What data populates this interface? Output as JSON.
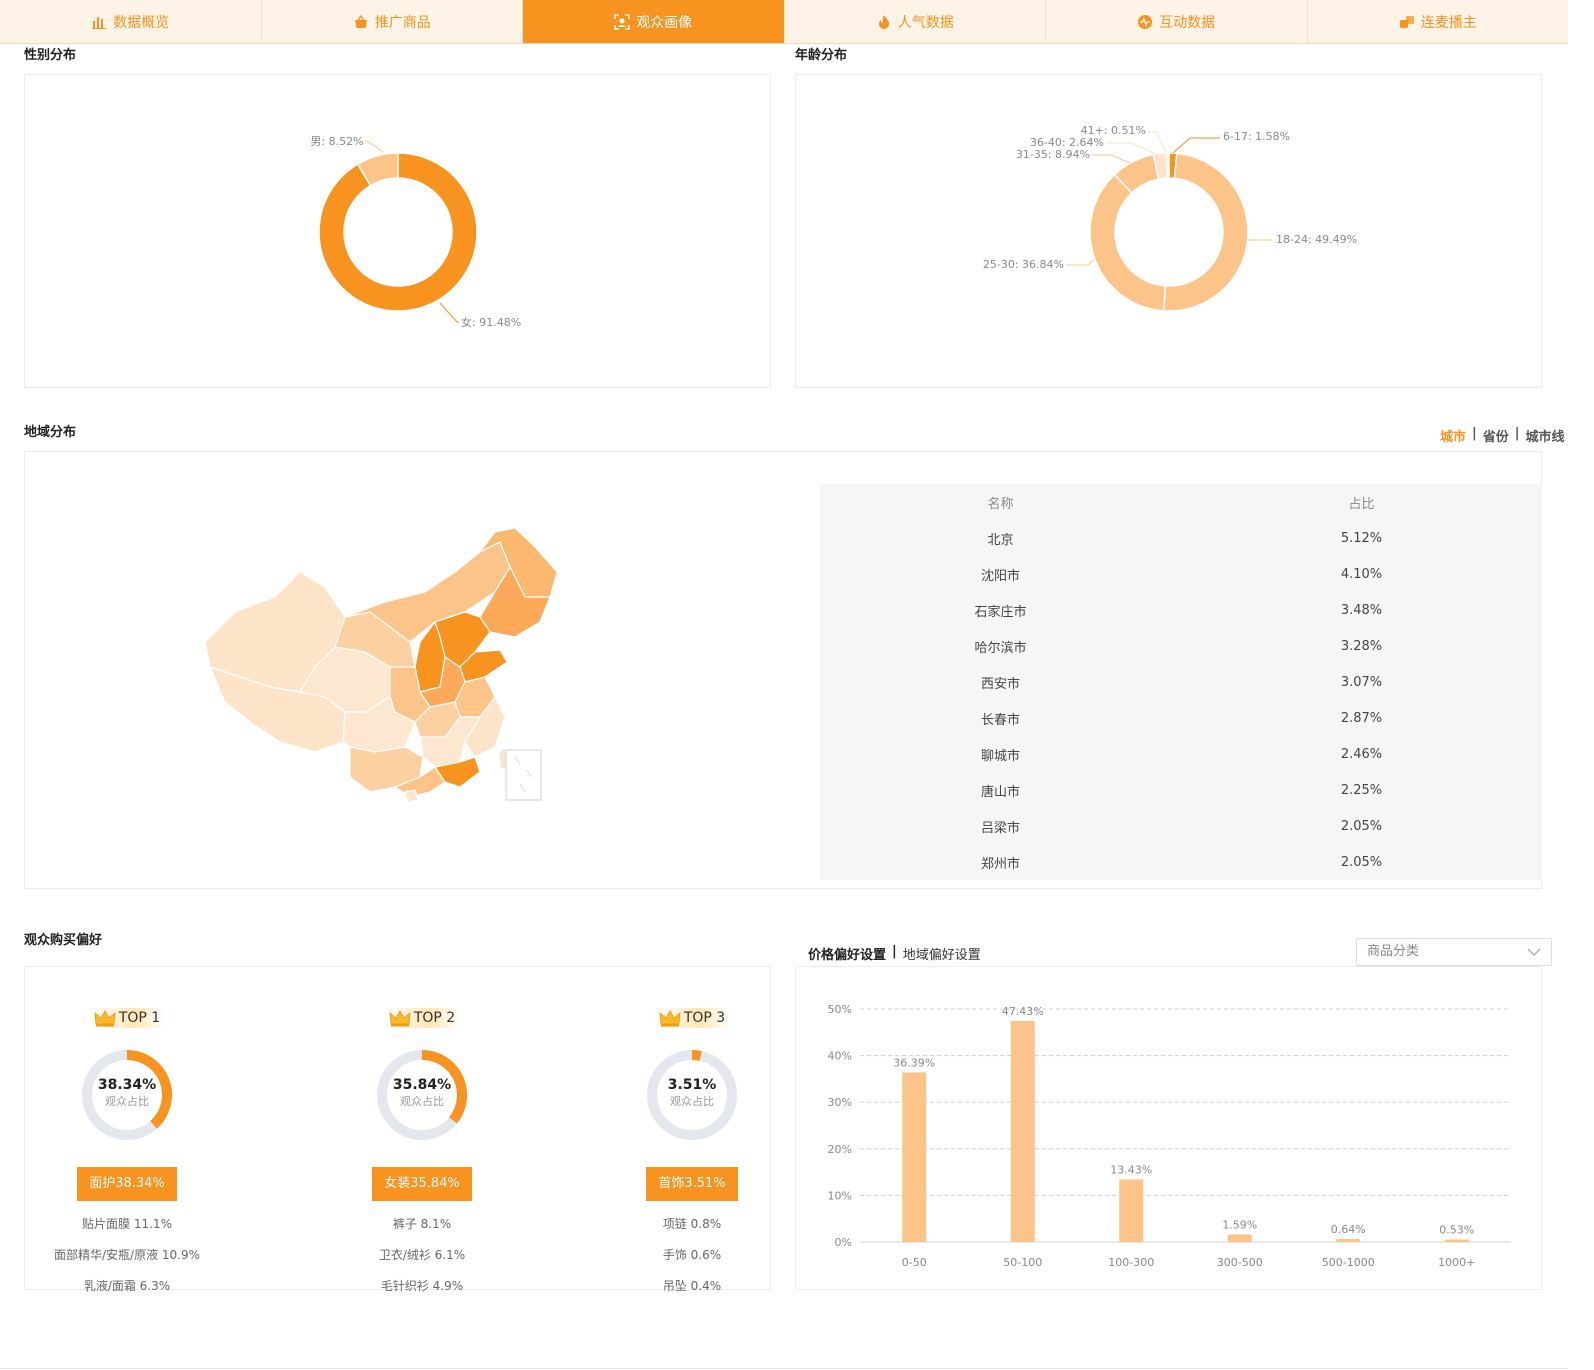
{
  "tabs": [
    {
      "label": "数据概览",
      "icon": "bar-chart-icon"
    },
    {
      "label": "推广商品",
      "icon": "shopping-basket-icon"
    },
    {
      "label": "观众画像",
      "icon": "face-scan-icon"
    },
    {
      "label": "人气数据",
      "icon": "flame-icon"
    },
    {
      "label": "互动数据",
      "icon": "pulse-icon"
    },
    {
      "label": "连麦播主",
      "icon": "link-mic-icon"
    }
  ],
  "active_tab": "观众画像",
  "colors": {
    "accent": "#f7931e",
    "light": "#fdc48a",
    "lighter": "#fde3c8",
    "tab_bg": "#fdf3e7"
  },
  "gender": {
    "title": "性别分布",
    "labels": [
      "男: 8.52%",
      "女: 91.48%"
    ],
    "chart_data": {
      "type": "pie",
      "categories": [
        "男",
        "女"
      ],
      "values": [
        8.52,
        91.48
      ]
    }
  },
  "age": {
    "title": "年龄分布",
    "labels": [
      "6-17: 1.58%",
      "18-24: 49.49%",
      "25-30: 36.84%",
      "31-35: 8.94%",
      "36-40: 2.64%",
      "41+: 0.51%"
    ],
    "chart_data": {
      "type": "pie",
      "categories": [
        "6-17",
        "18-24",
        "25-30",
        "31-35",
        "36-40",
        "41+"
      ],
      "values": [
        1.58,
        49.49,
        36.84,
        8.94,
        2.64,
        0.51
      ]
    }
  },
  "region": {
    "title": "地域分布",
    "toggles": [
      "城市",
      "省份",
      "城市线"
    ],
    "active_toggle": "城市",
    "table": {
      "headers": [
        "名称",
        "占比"
      ],
      "rows": [
        [
          "北京",
          "5.12%"
        ],
        [
          "沈阳市",
          "4.10%"
        ],
        [
          "石家庄市",
          "3.48%"
        ],
        [
          "哈尔滨市",
          "3.28%"
        ],
        [
          "西安市",
          "3.07%"
        ],
        [
          "长春市",
          "2.87%"
        ],
        [
          "聊城市",
          "2.46%"
        ],
        [
          "唐山市",
          "2.25%"
        ],
        [
          "吕梁市",
          "2.05%"
        ],
        [
          "郑州市",
          "2.05%"
        ]
      ]
    }
  },
  "preference": {
    "title": "观众购买偏好",
    "donut_label": "观众占比",
    "items": [
      {
        "rank": "TOP 1",
        "pct": "38.34%",
        "value": 38.34,
        "category": "面护38.34%",
        "subs": [
          "贴片面膜 11.1%",
          "面部精华/安瓶/原液 10.9%",
          "乳液/面霜 6.3%"
        ]
      },
      {
        "rank": "TOP 2",
        "pct": "35.84%",
        "value": 35.84,
        "category": "女装35.84%",
        "subs": [
          "裤子 8.1%",
          "卫衣/绒衫 6.1%",
          "毛针织衫 4.9%"
        ]
      },
      {
        "rank": "TOP 3",
        "pct": "3.51%",
        "value": 3.51,
        "category": "首饰3.51%",
        "subs": [
          "项链 0.8%",
          "手饰 0.6%",
          "吊坠 0.4%"
        ]
      }
    ]
  },
  "price": {
    "title": "价格偏好设置",
    "title2": "地域偏好设置",
    "select_placeholder": "商品分类",
    "chart_data": {
      "type": "bar",
      "categories": [
        "0-50",
        "50-100",
        "100-300",
        "300-500",
        "500-1000",
        "1000+"
      ],
      "values": [
        36.39,
        47.43,
        13.43,
        1.59,
        0.64,
        0.53
      ],
      "value_labels": [
        "36.39%",
        "47.43%",
        "13.43%",
        "1.59%",
        "0.64%",
        "0.53%"
      ],
      "y_ticks": [
        "0%",
        "10%",
        "20%",
        "30%",
        "40%",
        "50%"
      ],
      "ylim": [
        0,
        50
      ],
      "grid": true
    }
  }
}
